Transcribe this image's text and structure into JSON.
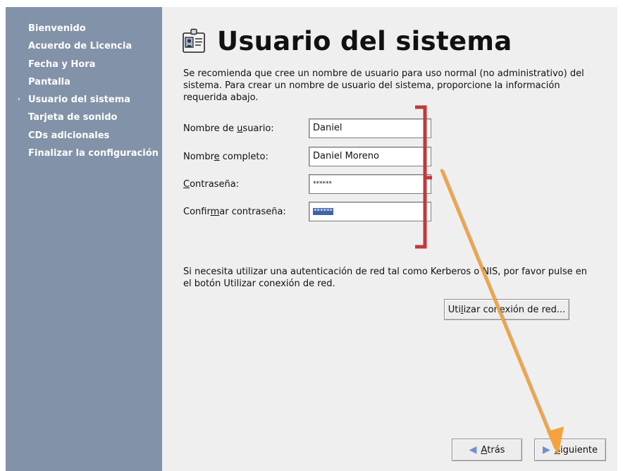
{
  "sidebar": {
    "items": [
      {
        "label": "Bienvenido",
        "active": false
      },
      {
        "label": "Acuerdo de Licencia",
        "active": false
      },
      {
        "label": "Fecha y Hora",
        "active": false
      },
      {
        "label": "Pantalla",
        "active": false
      },
      {
        "label": "Usuario del sistema",
        "active": true
      },
      {
        "label": "Tarjeta de sonido",
        "active": false
      },
      {
        "label": "CDs adicionales",
        "active": false
      },
      {
        "label": "Finalizar la configuración",
        "active": false
      }
    ],
    "active_marker": "›"
  },
  "header": {
    "title": "Usuario del sistema",
    "icon": "user-badge-icon"
  },
  "intro_text": "Se recomienda que cree un nombre de usuario para uso normal (no administrativo) del sistema. Para crear un nombre de usuario del sistema, proporcione la información requerida abajo.",
  "form": {
    "username": {
      "label_before": "Nombre de ",
      "label_mnemonic": "u",
      "label_after": "suario:",
      "value": "Daniel"
    },
    "fullname": {
      "label_before": "Nombr",
      "label_mnemonic": "e",
      "label_after": " completo:",
      "value": "Daniel Moreno"
    },
    "password": {
      "label_before": "",
      "label_mnemonic": "C",
      "label_after": "ontraseña:",
      "value": "******"
    },
    "confirm": {
      "label_before": "Confir",
      "label_mnemonic": "m",
      "label_after": "ar contraseña:",
      "value": "******"
    }
  },
  "network": {
    "text": "Si necesita utilizar una autenticación de red tal como Kerberos o NIS, por favor pulse en el botón Utilizar conexión de red.",
    "button_before": "Uti",
    "button_mnemonic": "l",
    "button_after": "izar conexión de red..."
  },
  "footer": {
    "back_mnemonic": "A",
    "back_after": "trás",
    "next_mnemonic": "S",
    "next_after": "iguiente"
  },
  "colors": {
    "sidebar": "#8292a8",
    "main_bg": "#efefef",
    "selection": "#3f63a7",
    "annotation_bracket": "#c0393b",
    "annotation_arrow": "#f5a23d"
  }
}
